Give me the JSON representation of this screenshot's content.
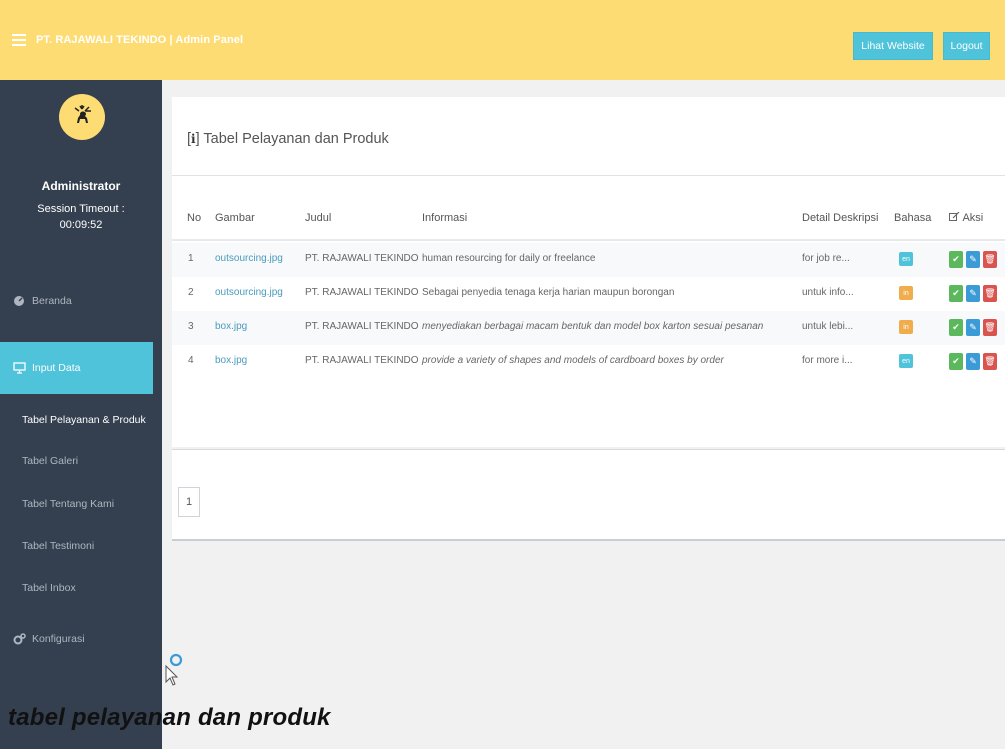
{
  "header": {
    "title": "PT. RAJAWALI TEKINDO | Admin Panel",
    "website_button": "Lihat Website",
    "logout_button": "Logout"
  },
  "sidebar": {
    "user_name": "Administrator",
    "session_label": "Session Timeout :",
    "session_time": "00:09:52",
    "nav": {
      "beranda": "Beranda",
      "input_data": "Input Data",
      "konfigurasi": "Konfigurasi"
    },
    "submenu": [
      "Tabel Pelayanan & Produk",
      "Tabel Galeri",
      "Tabel Tentang Kami",
      "Tabel Testimoni",
      "Tabel Inbox"
    ]
  },
  "panel": {
    "title_prefix": "[",
    "title_icon": "i",
    "title_suffix": "] Tabel Pelayanan dan Produk"
  },
  "table": {
    "headers": {
      "no": "No",
      "gambar": "Gambar",
      "judul": "Judul",
      "informasi": "Informasi",
      "detail": "Detail Deskripsi",
      "bahasa": "Bahasa",
      "aksi": "Aksi"
    },
    "rows": [
      {
        "no": "1",
        "gambar": "outsourcing.jpg",
        "judul": "PT. RAJAWALI TEKINDO",
        "informasi": "human resourcing for daily or freelance",
        "detail": "for job re...",
        "bahasa": "en"
      },
      {
        "no": "2",
        "gambar": "outsourcing.jpg",
        "judul": "PT. RAJAWALI TEKINDO",
        "informasi": "Sebagai penyedia tenaga kerja harian maupun borongan",
        "detail": "untuk info...",
        "bahasa": "in"
      },
      {
        "no": "3",
        "gambar": "box.jpg",
        "judul": "PT. RAJAWALI TEKINDO",
        "informasi": "menyediakan berbagai macam bentuk dan model box karton sesuai pesanan",
        "detail": "untuk lebi...",
        "bahasa": "in"
      },
      {
        "no": "4",
        "gambar": "box.jpg",
        "judul": "PT. RAJAWALI TEKINDO",
        "informasi": "provide a variety of shapes and models of cardboard boxes by order",
        "detail": "for more i...",
        "bahasa": "en"
      }
    ]
  },
  "pagination": {
    "current": "1"
  },
  "caption": "tabel pelayanan dan produk",
  "colors": {
    "topbar": "#fddc74",
    "sidebar": "#34404f",
    "accent": "#4fc3d9",
    "success": "#5cb85c",
    "primary": "#3b9bd7",
    "danger": "#d9534f",
    "warning": "#f0ad4e"
  },
  "icons": {
    "menu": "hamburger-icon",
    "avatar": "deer-icon",
    "beranda": "dashboard-icon",
    "input_data": "monitor-icon",
    "konfigurasi": "gears-icon",
    "aksi": "edit-icon",
    "row_actions": [
      "check-icon",
      "pencil-icon",
      "trash-icon"
    ]
  }
}
